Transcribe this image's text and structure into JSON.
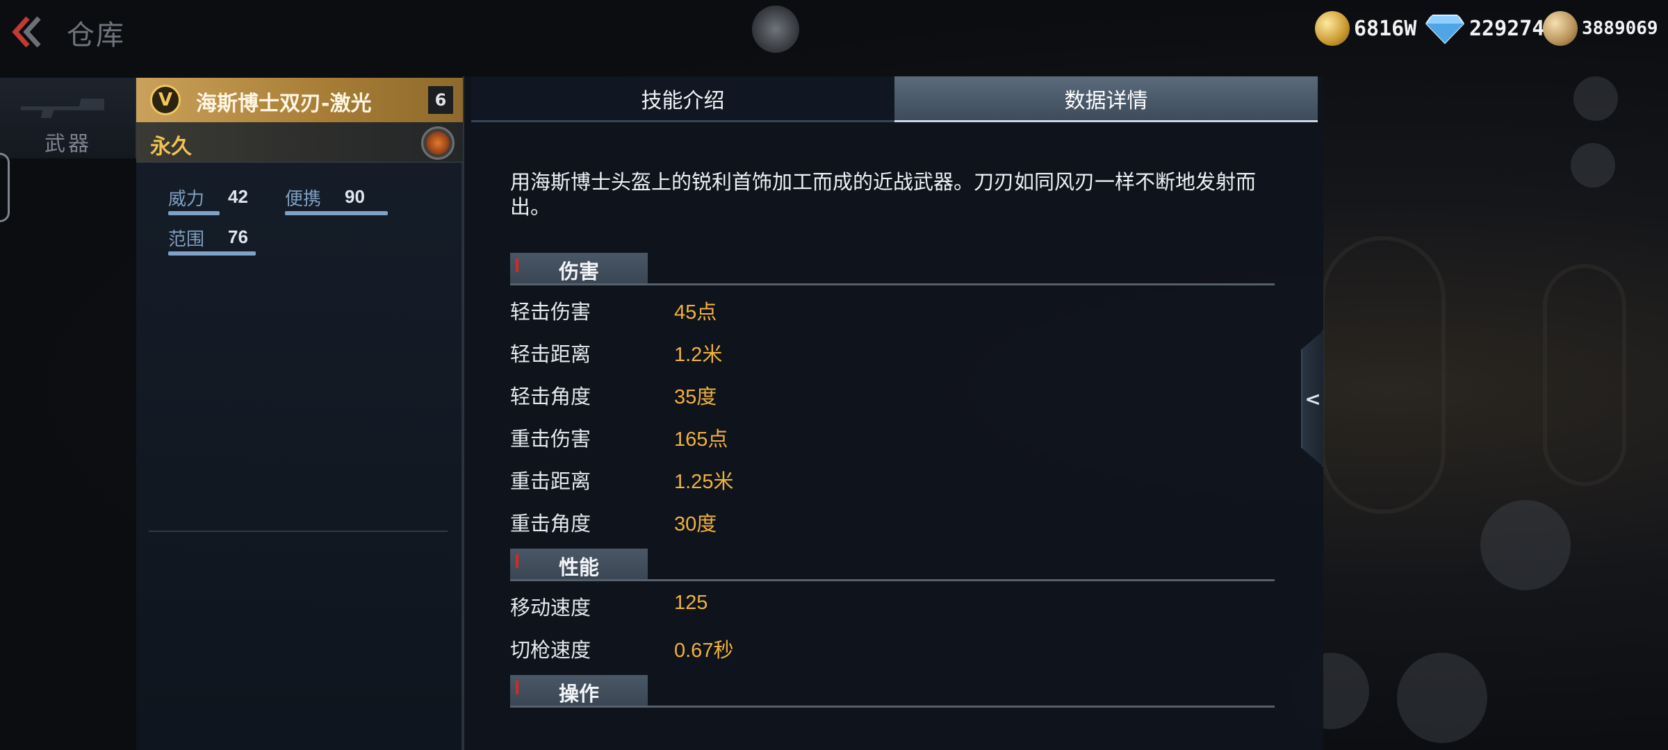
{
  "header": {
    "title": "仓库",
    "currencies": [
      {
        "icon": "gold-coin-icon",
        "value": "6816W"
      },
      {
        "icon": "diamond-icon",
        "value": "229274"
      },
      {
        "icon": "token-icon",
        "value": "3889069"
      }
    ]
  },
  "sidebar": {
    "tab_label": "武器"
  },
  "weapon": {
    "rank_letter": "V",
    "name": "海斯博士双刃-激光",
    "level": "6",
    "duration": "永久",
    "stats": [
      {
        "name": "威力",
        "value": "42",
        "level": 0.42
      },
      {
        "name": "便携",
        "value": "90",
        "level": 0.9
      },
      {
        "name": "范围",
        "value": "76",
        "level": 0.76
      }
    ]
  },
  "tabs": [
    {
      "label": "技能介绍",
      "active": false
    },
    {
      "label": "数据详情",
      "active": true
    }
  ],
  "details": {
    "description": "用海斯博士头盔上的锐利首饰加工而成的近战武器。刀刃如同风刃一样不断地发射而出。",
    "sections": [
      {
        "title": "伤害",
        "rows": [
          {
            "key": "轻击伤害",
            "value": "45点"
          },
          {
            "key": "轻击距离",
            "value": "1.2米"
          },
          {
            "key": "轻击角度",
            "value": "35度"
          },
          {
            "key": "重击伤害",
            "value": "165点"
          },
          {
            "key": "重击距离",
            "value": "1.25米"
          },
          {
            "key": "重击角度",
            "value": "30度"
          }
        ]
      },
      {
        "title": "性能",
        "rows": [
          {
            "key": "移动速度",
            "value": "125"
          },
          {
            "key": "切枪速度",
            "value": "0.67秒"
          }
        ]
      },
      {
        "title": "操作",
        "rows": []
      }
    ]
  },
  "colors": {
    "accent_gold": "#f0b23d",
    "rarity_gold": "#caa15a",
    "stat_blue": "#7fa2c8"
  }
}
